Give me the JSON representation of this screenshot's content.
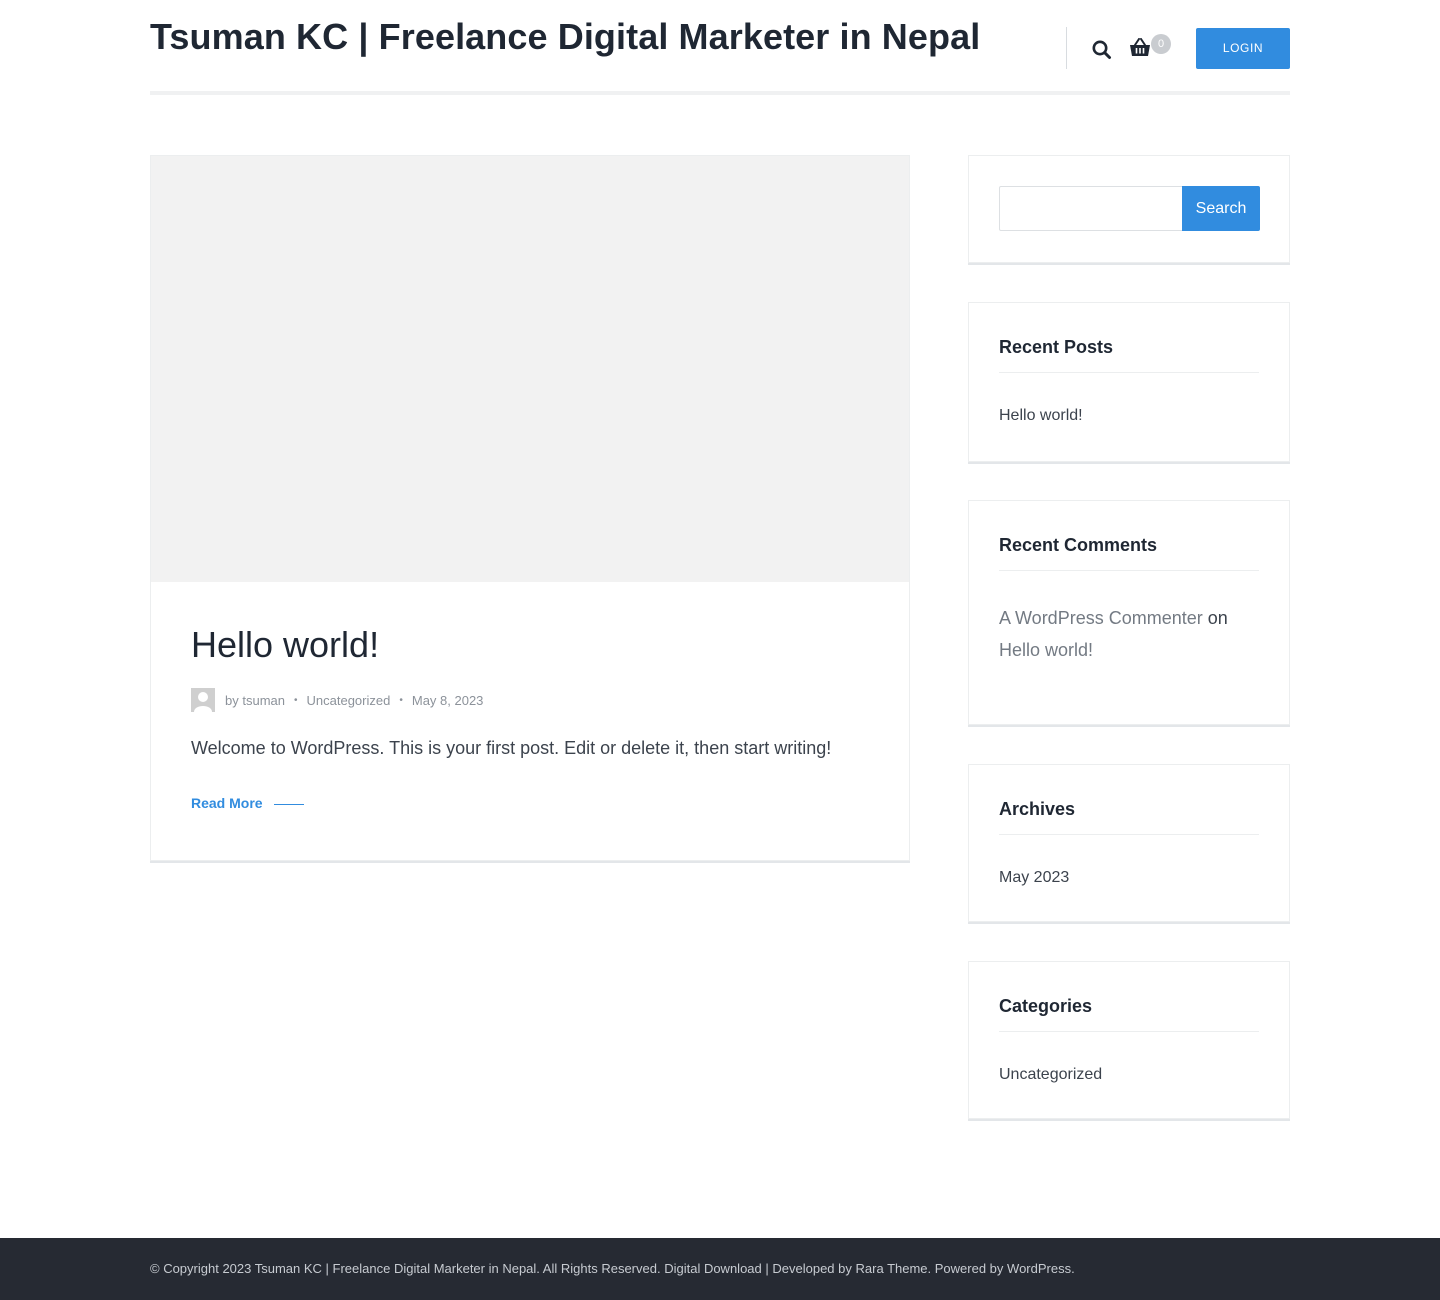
{
  "header": {
    "site_title": "Tsuman KC | Freelance Digital Marketer in Nepal",
    "cart_count": "0",
    "login_label": "LOGIN",
    "accent_color": "#318cdf"
  },
  "post": {
    "title": "Hello world!",
    "meta": {
      "by": "by",
      "author": "tsuman",
      "category": "Uncategorized",
      "date": "May 8, 2023",
      "separator": "•"
    },
    "excerpt": "Welcome to WordPress. This is your first post. Edit or delete it, then start writing!",
    "read_more": "Read More"
  },
  "sidebar": {
    "search": {
      "placeholder": "",
      "button_label": "Search"
    },
    "recent_posts": {
      "title": "Recent Posts",
      "items": [
        "Hello world!"
      ]
    },
    "recent_comments": {
      "title": "Recent Comments",
      "author": "A WordPress Commenter",
      "on": "on",
      "post": "Hello world!"
    },
    "archives": {
      "title": "Archives",
      "items": [
        "May 2023"
      ]
    },
    "categories": {
      "title": "Categories",
      "items": [
        "Uncategorized"
      ]
    }
  },
  "footer": {
    "copyright": "© Copyright 2023",
    "site_link": "Tsuman KC | Freelance Digital Marketer in Nepal",
    "rights": ". All Rights Reserved.",
    "theme_link": "Digital Download",
    "developed_by": "| Developed by",
    "developer_link": "Rara Theme",
    "powered_by": ". Powered by",
    "wp_link": "WordPress",
    "end": "."
  },
  "icons": {
    "search": "search-icon",
    "cart": "basket-icon",
    "avatar": "avatar-icon"
  }
}
